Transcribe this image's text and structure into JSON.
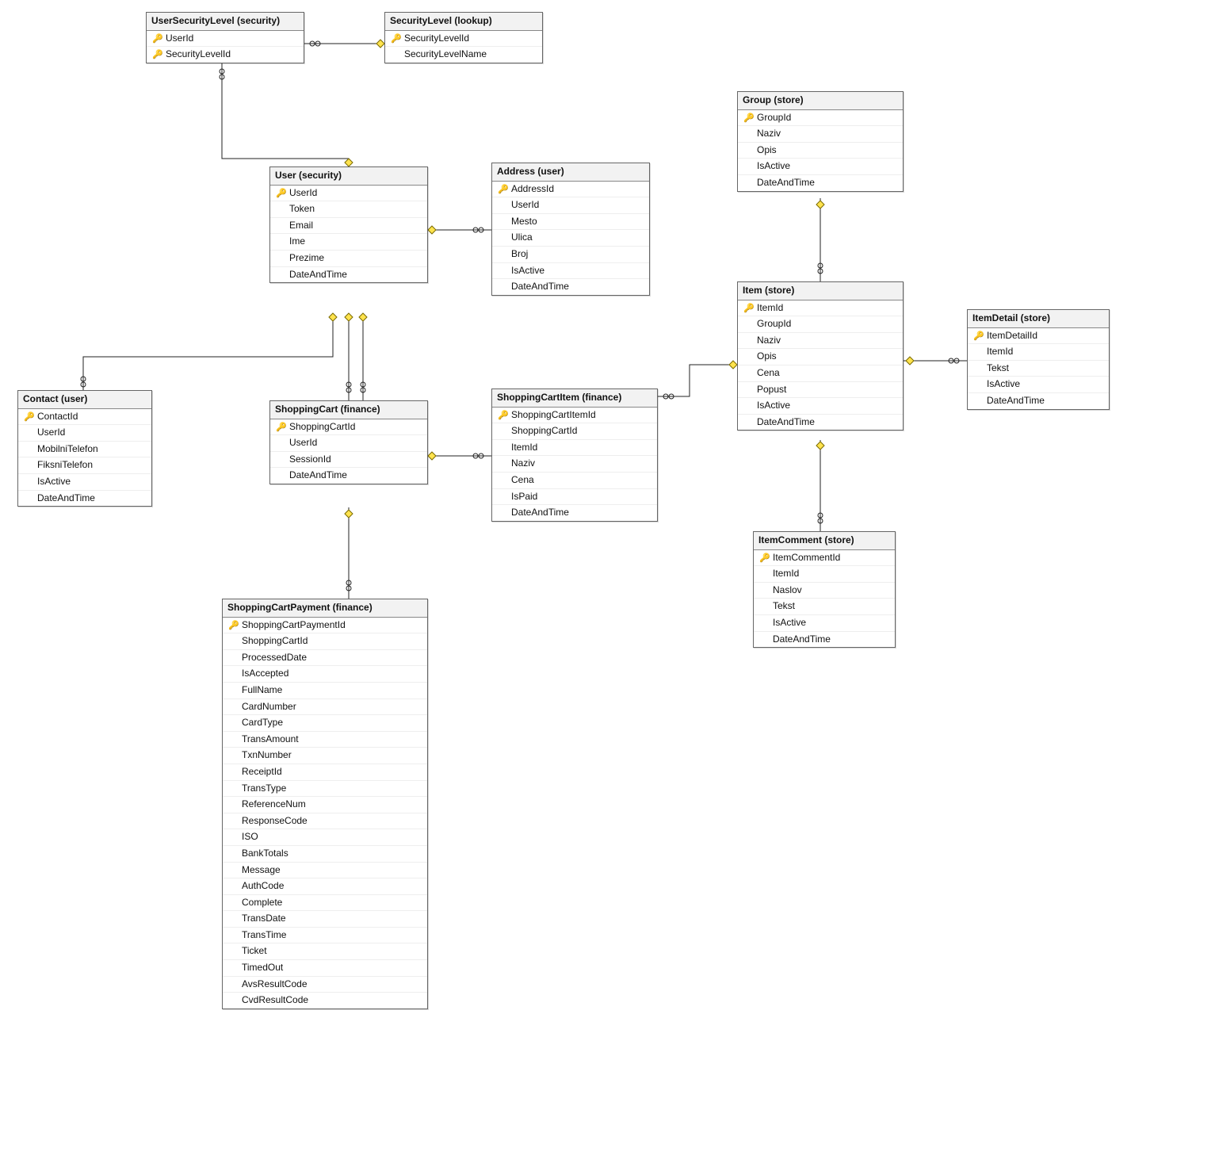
{
  "tables": {
    "userSecurityLevel": {
      "title": "UserSecurityLevel (security)",
      "columns": [
        {
          "name": "UserId",
          "pk": true
        },
        {
          "name": "SecurityLevelId",
          "pk": true
        }
      ]
    },
    "securityLevel": {
      "title": "SecurityLevel (lookup)",
      "columns": [
        {
          "name": "SecurityLevelId",
          "pk": true
        },
        {
          "name": "SecurityLevelName",
          "pk": false
        }
      ]
    },
    "user": {
      "title": "User (security)",
      "columns": [
        {
          "name": "UserId",
          "pk": true
        },
        {
          "name": "Token",
          "pk": false
        },
        {
          "name": "Email",
          "pk": false
        },
        {
          "name": "Ime",
          "pk": false
        },
        {
          "name": "Prezime",
          "pk": false
        },
        {
          "name": "DateAndTime",
          "pk": false
        }
      ]
    },
    "address": {
      "title": "Address (user)",
      "columns": [
        {
          "name": "AddressId",
          "pk": true
        },
        {
          "name": "UserId",
          "pk": false
        },
        {
          "name": "Mesto",
          "pk": false
        },
        {
          "name": "Ulica",
          "pk": false
        },
        {
          "name": "Broj",
          "pk": false
        },
        {
          "name": "IsActive",
          "pk": false
        },
        {
          "name": "DateAndTime",
          "pk": false
        }
      ]
    },
    "contact": {
      "title": "Contact (user)",
      "columns": [
        {
          "name": "ContactId",
          "pk": true
        },
        {
          "name": "UserId",
          "pk": false
        },
        {
          "name": "MobilniTelefon",
          "pk": false
        },
        {
          "name": "FiksniTelefon",
          "pk": false
        },
        {
          "name": "IsActive",
          "pk": false
        },
        {
          "name": "DateAndTime",
          "pk": false
        }
      ]
    },
    "shoppingCart": {
      "title": "ShoppingCart (finance)",
      "columns": [
        {
          "name": "ShoppingCartId",
          "pk": true
        },
        {
          "name": "UserId",
          "pk": false
        },
        {
          "name": "SessionId",
          "pk": false
        },
        {
          "name": "DateAndTime",
          "pk": false
        }
      ]
    },
    "shoppingCartItem": {
      "title": "ShoppingCartItem (finance)",
      "columns": [
        {
          "name": "ShoppingCartItemId",
          "pk": true
        },
        {
          "name": "ShoppingCartId",
          "pk": false
        },
        {
          "name": "ItemId",
          "pk": false
        },
        {
          "name": "Naziv",
          "pk": false
        },
        {
          "name": "Cena",
          "pk": false
        },
        {
          "name": "IsPaid",
          "pk": false
        },
        {
          "name": "DateAndTime",
          "pk": false
        }
      ]
    },
    "shoppingCartPayment": {
      "title": "ShoppingCartPayment (finance)",
      "columns": [
        {
          "name": "ShoppingCartPaymentId",
          "pk": true
        },
        {
          "name": "ShoppingCartId",
          "pk": false
        },
        {
          "name": "ProcessedDate",
          "pk": false
        },
        {
          "name": "IsAccepted",
          "pk": false
        },
        {
          "name": "FullName",
          "pk": false
        },
        {
          "name": "CardNumber",
          "pk": false
        },
        {
          "name": "CardType",
          "pk": false
        },
        {
          "name": "TransAmount",
          "pk": false
        },
        {
          "name": "TxnNumber",
          "pk": false
        },
        {
          "name": "ReceiptId",
          "pk": false
        },
        {
          "name": "TransType",
          "pk": false
        },
        {
          "name": "ReferenceNum",
          "pk": false
        },
        {
          "name": "ResponseCode",
          "pk": false
        },
        {
          "name": "ISO",
          "pk": false
        },
        {
          "name": "BankTotals",
          "pk": false
        },
        {
          "name": "Message",
          "pk": false
        },
        {
          "name": "AuthCode",
          "pk": false
        },
        {
          "name": "Complete",
          "pk": false
        },
        {
          "name": "TransDate",
          "pk": false
        },
        {
          "name": "TransTime",
          "pk": false
        },
        {
          "name": "Ticket",
          "pk": false
        },
        {
          "name": "TimedOut",
          "pk": false
        },
        {
          "name": "AvsResultCode",
          "pk": false
        },
        {
          "name": "CvdResultCode",
          "pk": false
        }
      ]
    },
    "group": {
      "title": "Group (store)",
      "columns": [
        {
          "name": "GroupId",
          "pk": true
        },
        {
          "name": "Naziv",
          "pk": false
        },
        {
          "name": "Opis",
          "pk": false
        },
        {
          "name": "IsActive",
          "pk": false
        },
        {
          "name": "DateAndTime",
          "pk": false
        }
      ]
    },
    "item": {
      "title": "Item (store)",
      "columns": [
        {
          "name": "ItemId",
          "pk": true
        },
        {
          "name": "GroupId",
          "pk": false
        },
        {
          "name": "Naziv",
          "pk": false
        },
        {
          "name": "Opis",
          "pk": false
        },
        {
          "name": "Cena",
          "pk": false
        },
        {
          "name": "Popust",
          "pk": false
        },
        {
          "name": "IsActive",
          "pk": false
        },
        {
          "name": "DateAndTime",
          "pk": false
        }
      ]
    },
    "itemDetail": {
      "title": "ItemDetail (store)",
      "columns": [
        {
          "name": "ItemDetailId",
          "pk": true
        },
        {
          "name": "ItemId",
          "pk": false
        },
        {
          "name": "Tekst",
          "pk": false
        },
        {
          "name": "IsActive",
          "pk": false
        },
        {
          "name": "DateAndTime",
          "pk": false
        }
      ]
    },
    "itemComment": {
      "title": "ItemComment (store)",
      "columns": [
        {
          "name": "ItemCommentId",
          "pk": true
        },
        {
          "name": "ItemId",
          "pk": false
        },
        {
          "name": "Naslov",
          "pk": false
        },
        {
          "name": "Tekst",
          "pk": false
        },
        {
          "name": "IsActive",
          "pk": false
        },
        {
          "name": "DateAndTime",
          "pk": false
        }
      ]
    }
  },
  "relationships": [
    {
      "from": "userSecurityLevel",
      "to": "securityLevel",
      "fk": "SecurityLevelId",
      "cardinality": "many-to-one"
    },
    {
      "from": "userSecurityLevel",
      "to": "user",
      "fk": "UserId",
      "cardinality": "many-to-one"
    },
    {
      "from": "address",
      "to": "user",
      "fk": "UserId",
      "cardinality": "many-to-one"
    },
    {
      "from": "contact",
      "to": "user",
      "fk": "UserId",
      "cardinality": "many-to-one"
    },
    {
      "from": "shoppingCart",
      "to": "user",
      "fk": "UserId",
      "cardinality": "many-to-one"
    },
    {
      "from": "shoppingCartItem",
      "to": "shoppingCart",
      "fk": "ShoppingCartId",
      "cardinality": "many-to-one"
    },
    {
      "from": "shoppingCartItem",
      "to": "item",
      "fk": "ItemId",
      "cardinality": "many-to-one"
    },
    {
      "from": "shoppingCartPayment",
      "to": "shoppingCart",
      "fk": "ShoppingCartId",
      "cardinality": "many-to-one"
    },
    {
      "from": "item",
      "to": "group",
      "fk": "GroupId",
      "cardinality": "many-to-one"
    },
    {
      "from": "itemDetail",
      "to": "item",
      "fk": "ItemId",
      "cardinality": "many-to-one"
    },
    {
      "from": "itemComment",
      "to": "item",
      "fk": "ItemId",
      "cardinality": "many-to-one"
    }
  ]
}
